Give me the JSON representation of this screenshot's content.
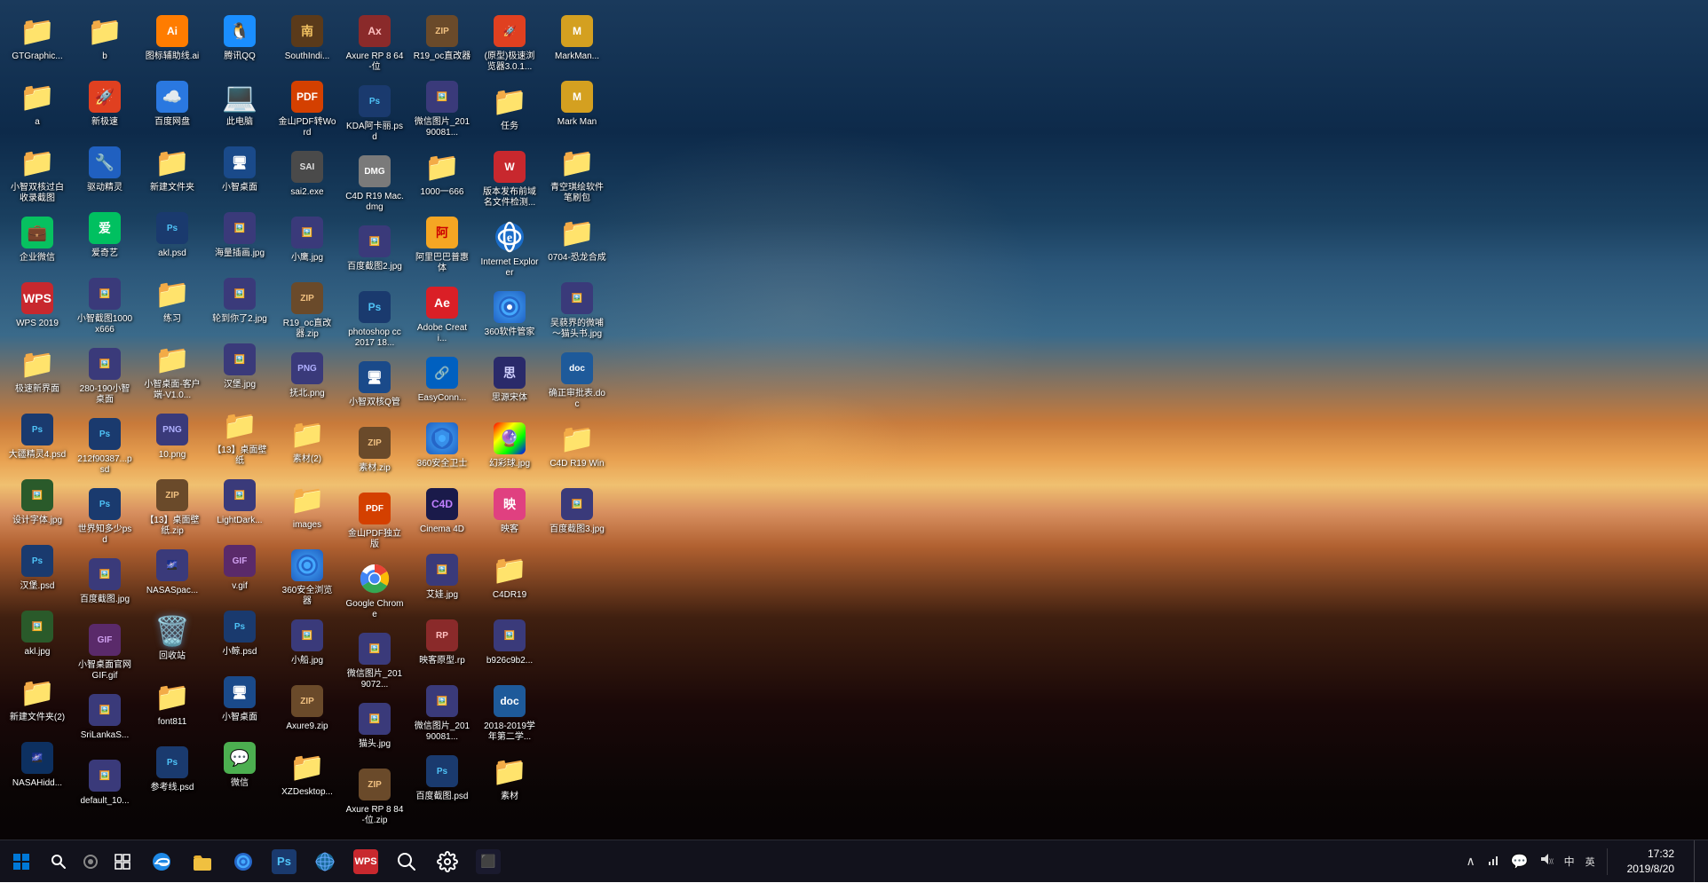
{
  "desktop": {
    "background": "mountain-landscape",
    "icons": [
      {
        "id": 1,
        "label": "GTGraphic...",
        "type": "folder",
        "row": 1,
        "col": 1
      },
      {
        "id": 2,
        "label": "a",
        "type": "folder",
        "row": 2,
        "col": 1
      },
      {
        "id": 3,
        "label": "小智双核过白收录截图",
        "type": "folder",
        "row": 3,
        "col": 1
      },
      {
        "id": 4,
        "label": "企业微信",
        "type": "app",
        "row": 4,
        "col": 1
      },
      {
        "id": 5,
        "label": "WPS 2019",
        "type": "app-wps",
        "row": 5,
        "col": 1
      },
      {
        "id": 6,
        "label": "极速新界面",
        "type": "folder",
        "row": 6,
        "col": 1
      },
      {
        "id": 7,
        "label": "大疆精灵4.psd",
        "type": "psd",
        "row": 7,
        "col": 1
      },
      {
        "id": 8,
        "label": "设计字体.jpg",
        "type": "jpg",
        "row": 8,
        "col": 1
      },
      {
        "id": 9,
        "label": "汉堡.psd",
        "type": "psd",
        "row": 9,
        "col": 1
      },
      {
        "id": 10,
        "label": "akl.jpg",
        "type": "jpg",
        "row": 10,
        "col": 1
      },
      {
        "id": 11,
        "label": "新建文件夹(2)",
        "type": "folder",
        "row": 11,
        "col": 1
      },
      {
        "id": 12,
        "label": "NASAHidd...",
        "type": "jpg",
        "row": 1,
        "col": 2
      },
      {
        "id": 13,
        "label": "b",
        "type": "folder",
        "row": 2,
        "col": 2
      },
      {
        "id": 14,
        "label": "新极速",
        "type": "app",
        "row": 3,
        "col": 2
      },
      {
        "id": 15,
        "label": "驱动精灵",
        "type": "app",
        "row": 4,
        "col": 2
      },
      {
        "id": 16,
        "label": "爱奇艺",
        "type": "app",
        "row": 5,
        "col": 2
      },
      {
        "id": 17,
        "label": "小智截图1000x666",
        "type": "jpg",
        "row": 6,
        "col": 2
      },
      {
        "id": 18,
        "label": "280-190小智桌面",
        "type": "jpg",
        "row": 7,
        "col": 2
      },
      {
        "id": 19,
        "label": "212f90387...psd",
        "type": "psd",
        "row": 8,
        "col": 2
      },
      {
        "id": 20,
        "label": "世界知多少psd",
        "type": "psd",
        "row": 9,
        "col": 2
      },
      {
        "id": 21,
        "label": "百度截图.jpg",
        "type": "jpg",
        "row": 10,
        "col": 2
      },
      {
        "id": 22,
        "label": "小智桌面官网GIF.gif",
        "type": "gif",
        "row": 11,
        "col": 2
      },
      {
        "id": 23,
        "label": "SriLankaS...",
        "type": "jpg",
        "row": 1,
        "col": 3
      },
      {
        "id": 24,
        "label": "default_10...",
        "type": "jpg",
        "row": 2,
        "col": 3
      },
      {
        "id": 25,
        "label": "图标辅助线.ai",
        "type": "ai",
        "row": 3,
        "col": 3
      },
      {
        "id": 26,
        "label": "百度网盘",
        "type": "app",
        "row": 4,
        "col": 3
      },
      {
        "id": 27,
        "label": "新建文件夹",
        "type": "folder",
        "row": 5,
        "col": 3
      },
      {
        "id": 28,
        "label": "akl.psd",
        "type": "psd",
        "row": 6,
        "col": 3
      },
      {
        "id": 29,
        "label": "练习",
        "type": "folder",
        "row": 7,
        "col": 3
      },
      {
        "id": 30,
        "label": "小智桌面-客户端-V1.0...",
        "type": "folder",
        "row": 8,
        "col": 3
      },
      {
        "id": 31,
        "label": "10.png",
        "type": "png",
        "row": 9,
        "col": 3
      },
      {
        "id": 32,
        "label": "【13】桌面壁纸.zip",
        "type": "zip",
        "row": 10,
        "col": 3
      },
      {
        "id": 33,
        "label": "NASASpac...",
        "type": "jpg",
        "row": 11,
        "col": 3
      },
      {
        "id": 34,
        "label": "回收站",
        "type": "recycle",
        "row": 1,
        "col": 4
      },
      {
        "id": 35,
        "label": "font811",
        "type": "folder",
        "row": 2,
        "col": 4
      },
      {
        "id": 36,
        "label": "参考线.psd",
        "type": "psd",
        "row": 3,
        "col": 4
      },
      {
        "id": 37,
        "label": "腾讯QQ",
        "type": "app-qq",
        "row": 4,
        "col": 4
      },
      {
        "id": 38,
        "label": "此电脑",
        "type": "computer",
        "row": 5,
        "col": 4
      },
      {
        "id": 39,
        "label": "小智桌面",
        "type": "app",
        "row": 6,
        "col": 4
      },
      {
        "id": 40,
        "label": "海量插画.jpg",
        "type": "jpg",
        "row": 7,
        "col": 4
      },
      {
        "id": 41,
        "label": "轮到你了2.jpg",
        "type": "jpg",
        "row": 8,
        "col": 4
      },
      {
        "id": 42,
        "label": "汉堡.jpg",
        "type": "jpg",
        "row": 9,
        "col": 4
      },
      {
        "id": 43,
        "label": "【13】桌面壁纸",
        "type": "folder",
        "row": 10,
        "col": 4
      },
      {
        "id": 44,
        "label": "LightDark...",
        "type": "jpg",
        "row": 11,
        "col": 4
      },
      {
        "id": 45,
        "label": "v.gif",
        "type": "gif",
        "row": 1,
        "col": 5
      },
      {
        "id": 46,
        "label": "小鲸.psd",
        "type": "psd",
        "row": 2,
        "col": 5
      },
      {
        "id": 47,
        "label": "小智桌面",
        "type": "app",
        "row": 3,
        "col": 5
      },
      {
        "id": 48,
        "label": "微信",
        "type": "app-wechat",
        "row": 4,
        "col": 5
      },
      {
        "id": 49,
        "label": "SouthIndi...",
        "type": "app",
        "row": 5,
        "col": 5
      },
      {
        "id": 50,
        "label": "金山PDF转Word",
        "type": "app",
        "row": 6,
        "col": 5
      },
      {
        "id": 51,
        "label": "sai2.exe",
        "type": "exe",
        "row": 7,
        "col": 5
      },
      {
        "id": 52,
        "label": "小鹰.jpg",
        "type": "jpg",
        "row": 8,
        "col": 5
      },
      {
        "id": 53,
        "label": "R19_oc直改器.zip",
        "type": "zip",
        "row": 9,
        "col": 5
      },
      {
        "id": 54,
        "label": "抚北.png",
        "type": "png",
        "row": 10,
        "col": 5
      },
      {
        "id": 55,
        "label": "素材(2)",
        "type": "folder",
        "row": 1,
        "col": 6
      },
      {
        "id": 56,
        "label": "images",
        "type": "folder",
        "row": 2,
        "col": 6
      },
      {
        "id": 57,
        "label": "360安全浏览器",
        "type": "app-360",
        "row": 3,
        "col": 6
      },
      {
        "id": 58,
        "label": "小船.jpg",
        "type": "jpg",
        "row": 4,
        "col": 6
      },
      {
        "id": 59,
        "label": "Axure9.zip",
        "type": "zip",
        "row": 5,
        "col": 6
      },
      {
        "id": 60,
        "label": "XZDesktop...",
        "type": "folder",
        "row": 6,
        "col": 6
      },
      {
        "id": 61,
        "label": "Axure RP 8 64-位",
        "type": "app",
        "row": 7,
        "col": 6
      },
      {
        "id": 62,
        "label": "KDA阿卡丽.psd",
        "type": "psd",
        "row": 8,
        "col": 6
      },
      {
        "id": 63,
        "label": "C4D R19 Mac.dmg",
        "type": "dmg",
        "row": 9,
        "col": 6
      },
      {
        "id": 64,
        "label": "百度截图2.jpg",
        "type": "jpg",
        "row": 10,
        "col": 6
      },
      {
        "id": 65,
        "label": "photoshop cc 2017 18...",
        "type": "app-ps",
        "row": 1,
        "col": 7
      },
      {
        "id": 66,
        "label": "小智双核Q管",
        "type": "app",
        "row": 2,
        "col": 7
      },
      {
        "id": 67,
        "label": "素材.zip",
        "type": "zip",
        "row": 3,
        "col": 7
      },
      {
        "id": 68,
        "label": "金山PDF独立版",
        "type": "app",
        "row": 4,
        "col": 7
      },
      {
        "id": 69,
        "label": "Google Chrome",
        "type": "app-chrome",
        "row": 5,
        "col": 7
      },
      {
        "id": 70,
        "label": "微信图片_2019072...",
        "type": "jpg",
        "row": 6,
        "col": 7
      },
      {
        "id": 71,
        "label": "猫头.jpg",
        "type": "jpg",
        "row": 7,
        "col": 7
      },
      {
        "id": 72,
        "label": "Axure RP 8 84-位.zip",
        "type": "zip",
        "row": 8,
        "col": 7
      },
      {
        "id": 73,
        "label": "R19_oc直改器",
        "type": "zip",
        "row": 9,
        "col": 7
      },
      {
        "id": 74,
        "label": "微信图片_20190081...",
        "type": "jpg",
        "row": 10,
        "col": 7
      },
      {
        "id": 75,
        "label": "1000一666",
        "type": "folder",
        "row": 1,
        "col": 8
      },
      {
        "id": 76,
        "label": "阿里巴巴普惠体",
        "type": "folder",
        "row": 2,
        "col": 8
      },
      {
        "id": 77,
        "label": "Adobe Creati...",
        "type": "app-adobe",
        "row": 3,
        "col": 8
      },
      {
        "id": 78,
        "label": "EasyConn...",
        "type": "app",
        "row": 4,
        "col": 8
      },
      {
        "id": 79,
        "label": "360安全卫士",
        "type": "app-360",
        "row": 5,
        "col": 8
      },
      {
        "id": 80,
        "label": "Cinema 4D",
        "type": "app",
        "row": 6,
        "col": 8
      },
      {
        "id": 81,
        "label": "艾娃.jpg",
        "type": "jpg",
        "row": 7,
        "col": 8
      },
      {
        "id": 82,
        "label": "映客原型.rp",
        "type": "rp",
        "row": 8,
        "col": 8
      },
      {
        "id": 83,
        "label": "微信图片_20190081...",
        "type": "jpg",
        "row": 9,
        "col": 8
      },
      {
        "id": 84,
        "label": "百度截图.psd",
        "type": "psd",
        "row": 10,
        "col": 8
      },
      {
        "id": 85,
        "label": "(原型)极速浏览器3.0.1...",
        "type": "app",
        "row": 1,
        "col": 9
      },
      {
        "id": 86,
        "label": "任务",
        "type": "folder",
        "row": 2,
        "col": 9
      },
      {
        "id": 87,
        "label": "版本发布前域名文件检测...",
        "type": "app-wps",
        "row": 3,
        "col": 9
      },
      {
        "id": 88,
        "label": "Internet Explorer",
        "type": "app-ie",
        "row": 4,
        "col": 9
      },
      {
        "id": 89,
        "label": "360软件管家",
        "type": "app-360",
        "row": 5,
        "col": 9
      },
      {
        "id": 90,
        "label": "思源宋体",
        "type": "app",
        "row": 6,
        "col": 9
      },
      {
        "id": 91,
        "label": "幻彩球.jpg",
        "type": "jpg",
        "row": 7,
        "col": 9
      },
      {
        "id": 92,
        "label": "映客",
        "type": "app",
        "row": 8,
        "col": 9
      },
      {
        "id": 93,
        "label": "C4DR19",
        "type": "folder",
        "row": 9,
        "col": 9
      },
      {
        "id": 94,
        "label": "b926c9b2...",
        "type": "jpg",
        "row": 10,
        "col": 9
      },
      {
        "id": 95,
        "label": "2018-2019学年第二学...",
        "type": "doc",
        "row": 1,
        "col": 10
      },
      {
        "id": 96,
        "label": "素材",
        "type": "folder",
        "row": 2,
        "col": 10
      },
      {
        "id": 97,
        "label": "MarkMan...",
        "type": "app",
        "row": 3,
        "col": 10
      },
      {
        "id": 98,
        "label": "Mark Man",
        "type": "app",
        "row": 4,
        "col": 10
      },
      {
        "id": 99,
        "label": "青空琪绘软件笔刷包",
        "type": "folder",
        "row": 5,
        "col": 10
      },
      {
        "id": 100,
        "label": "0704-恐龙合成",
        "type": "folder",
        "row": 6,
        "col": 10
      },
      {
        "id": 101,
        "label": "吴藐界的微哺～猫头书.jpg",
        "type": "jpg",
        "row": 7,
        "col": 10
      },
      {
        "id": 102,
        "label": "确正审批表.doc",
        "type": "doc",
        "row": 8,
        "col": 10
      },
      {
        "id": 103,
        "label": "C4D R19 Win",
        "type": "folder",
        "row": 9,
        "col": 10
      },
      {
        "id": 104,
        "label": "百度截图3.jpg",
        "type": "jpg",
        "row": 10,
        "col": 10
      }
    ]
  },
  "taskbar": {
    "start_label": "⊞",
    "search_label": "🔍",
    "clock": {
      "time": "17:32",
      "date": "2019/8/20"
    },
    "pinned_apps": [
      {
        "id": "edge",
        "label": "Edge",
        "icon": "edge"
      },
      {
        "id": "explorer",
        "label": "文件资源管理器",
        "icon": "explorer"
      },
      {
        "id": "360browser",
        "label": "360浏览器",
        "icon": "360"
      },
      {
        "id": "ps",
        "label": "Photoshop",
        "icon": "ps"
      },
      {
        "id": "globe",
        "label": "Globe",
        "icon": "globe"
      },
      {
        "id": "wps",
        "label": "WPS",
        "icon": "wps"
      },
      {
        "id": "search2",
        "label": "搜索",
        "icon": "search2"
      },
      {
        "id": "settings",
        "label": "设置",
        "icon": "settings"
      },
      {
        "id": "cmd",
        "label": "命令",
        "icon": "cmd"
      }
    ],
    "tray_icons": [
      "网络",
      "音量",
      "输入法",
      "中",
      "英"
    ]
  }
}
